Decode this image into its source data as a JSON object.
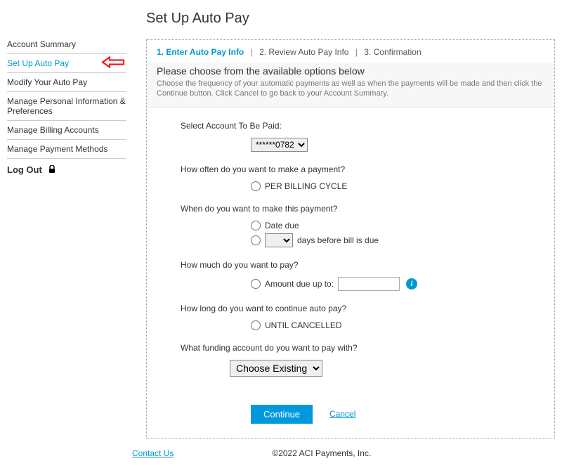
{
  "page": {
    "title": "Set Up Auto Pay"
  },
  "sidebar": {
    "items": [
      {
        "label": "Account Summary"
      },
      {
        "label": "Set Up Auto Pay"
      },
      {
        "label": "Modify Your Auto Pay"
      },
      {
        "label": "Manage Personal Information & Preferences"
      },
      {
        "label": "Manage Billing Accounts"
      },
      {
        "label": "Manage Payment Methods"
      },
      {
        "label": "Log Out"
      }
    ]
  },
  "steps": {
    "s1": "1. Enter Auto Pay Info",
    "s2": "2. Review Auto Pay Info",
    "s3": "3. Confirmation"
  },
  "intro": {
    "title": "Please choose from the available options below",
    "text": "Choose the frequency of your automatic payments as well as when the payments will be made and then click the Continue button. Click Cancel to go back to your Account Summary."
  },
  "form": {
    "selectAccountLabel": "Select Account To Be Paid:",
    "accountSelected": "******0782",
    "howOftenLabel": "How often do you want to make a payment?",
    "perBillingCycle": "PER BILLING CYCLE",
    "whenLabel": "When do you want to make this payment?",
    "dateDue": "Date due",
    "daysBefore": "days before bill is due",
    "howMuchLabel": "How much do you want to pay?",
    "amountDueUpTo": "Amount due up to:",
    "howLongLabel": "How long do you want to continue auto pay?",
    "untilCancelled": "UNTIL CANCELLED",
    "fundingLabel": "What funding account do you want to pay with?",
    "chooseExisting": "Choose Existing"
  },
  "actions": {
    "continue": "Continue",
    "cancel": "Cancel"
  },
  "footer": {
    "contact": "Contact Us",
    "copyright": "©2022 ACI Payments, Inc."
  }
}
